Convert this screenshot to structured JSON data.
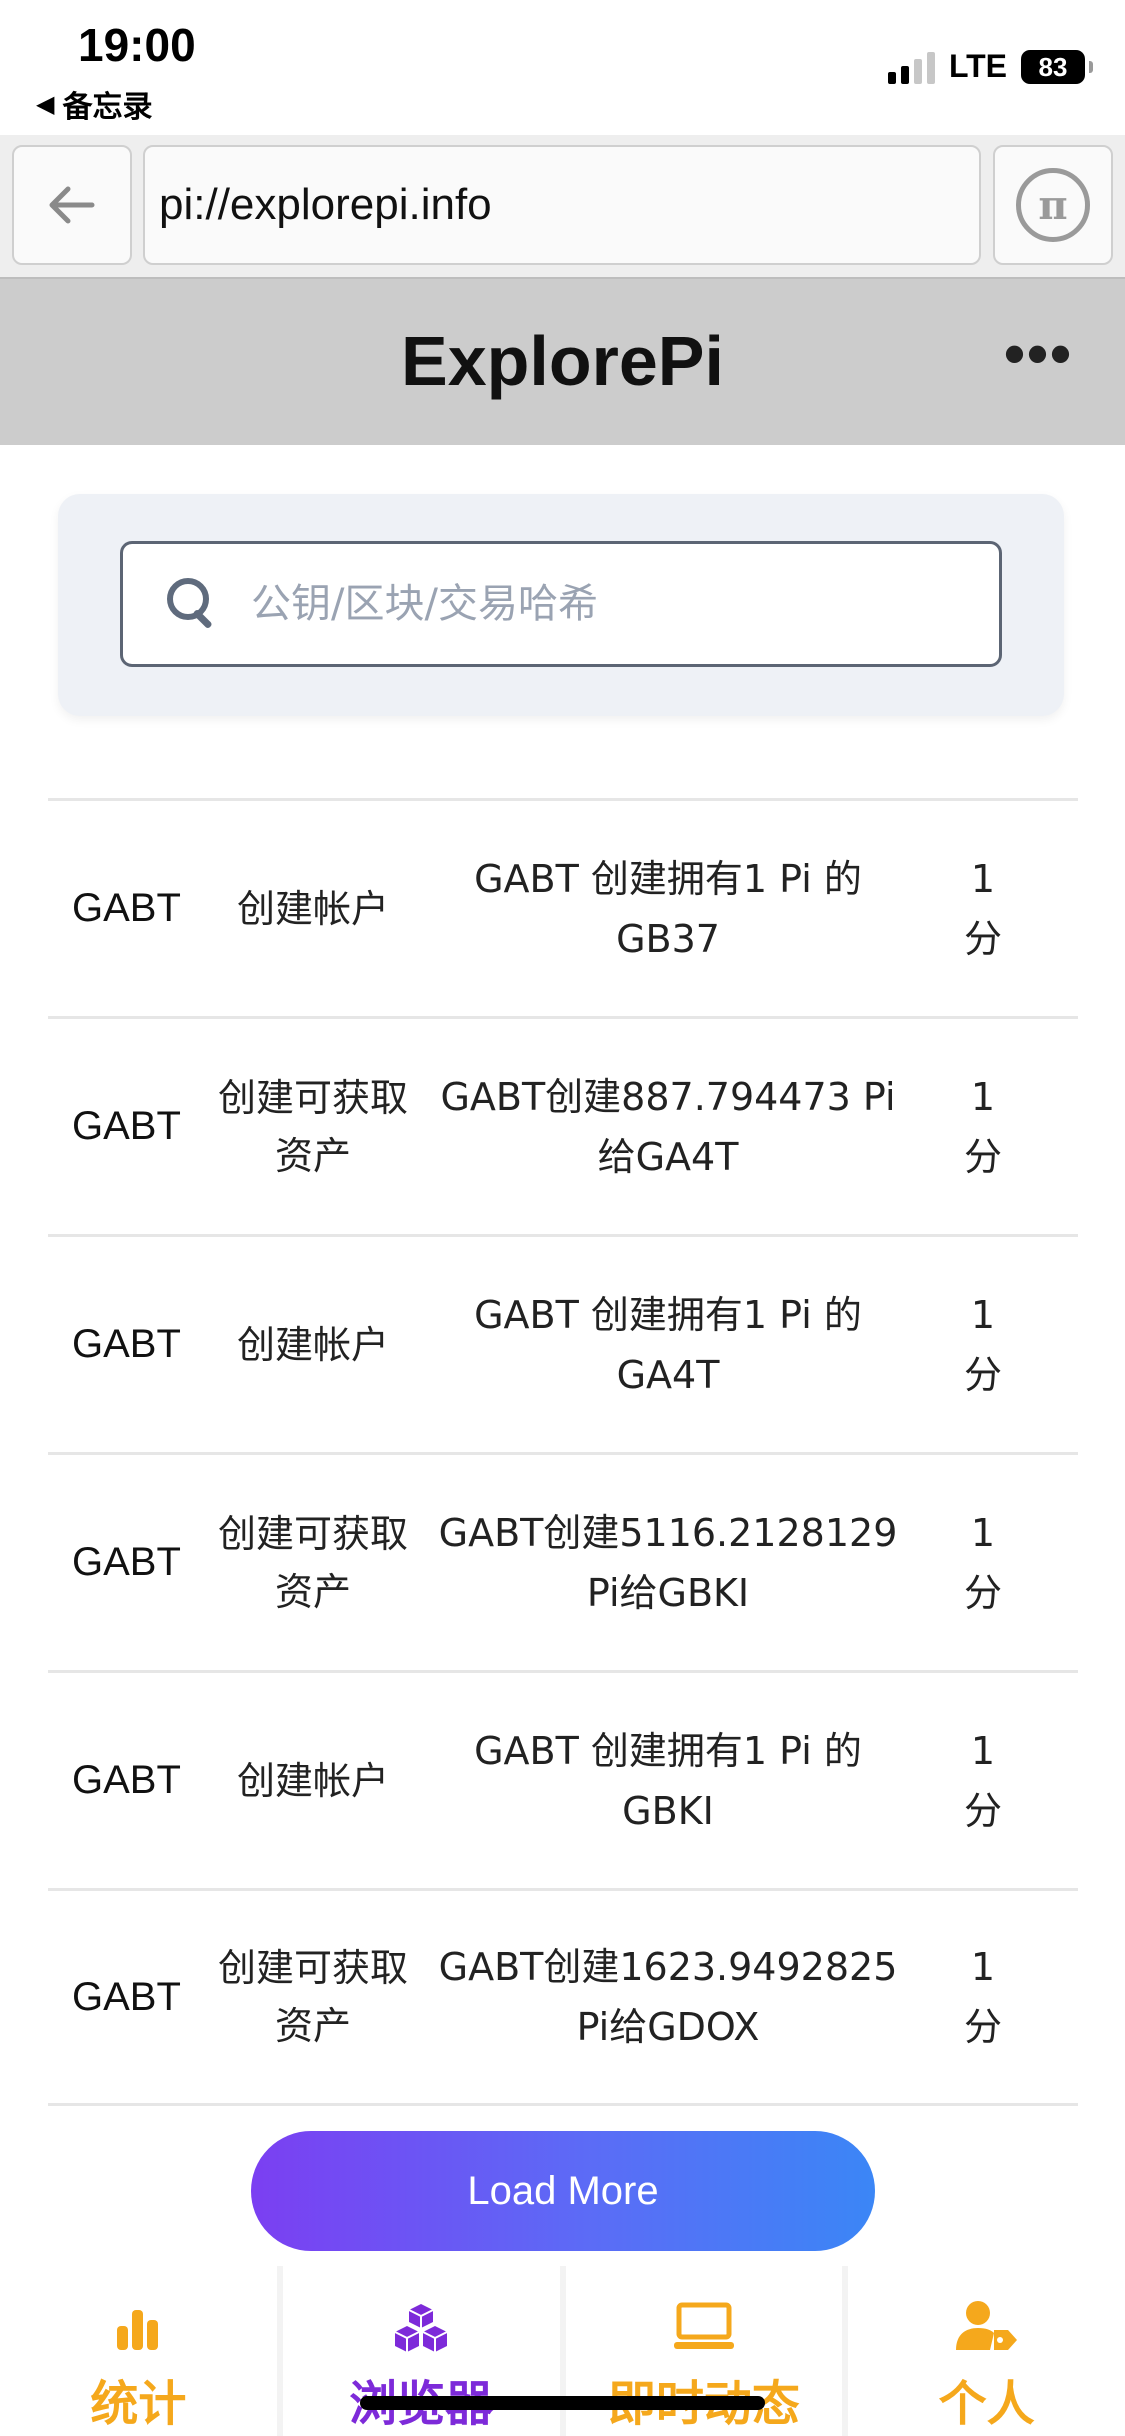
{
  "status_bar": {
    "time": "19:00",
    "back_app": "备忘录",
    "network": "LTE",
    "battery": "83"
  },
  "browser": {
    "url": "pi://explorepi.info"
  },
  "header": {
    "title": "ExplorePi",
    "more": "•••"
  },
  "search": {
    "placeholder": "公钥/区块/交易哈希"
  },
  "transactions": [
    {
      "account": "GABT",
      "type": "创建帐户",
      "desc": "GABT 创建拥有1 Pi 的 GB37",
      "time": "1 分"
    },
    {
      "account": "GABT",
      "type": "创建可获取资产",
      "desc": "GABT创建887.794473 Pi给GA4T",
      "time": "1 分"
    },
    {
      "account": "GABT",
      "type": "创建帐户",
      "desc": "GABT 创建拥有1 Pi 的 GA4T",
      "time": "1 分"
    },
    {
      "account": "GABT",
      "type": "创建可获取资产",
      "desc": "GABT创建5116.2128129 Pi给GBKI",
      "time": "1 分"
    },
    {
      "account": "GABT",
      "type": "创建帐户",
      "desc": "GABT 创建拥有1 Pi 的 GBKI",
      "time": "1 分"
    },
    {
      "account": "GABT",
      "type": "创建可获取资产",
      "desc": "GABT创建1623.9492825 Pi给GDOX",
      "time": "1 分"
    }
  ],
  "load_more": "Load More",
  "tabs": [
    {
      "label": "统计",
      "icon": "bar-chart-icon"
    },
    {
      "label": "浏览器",
      "icon": "blocks-icon"
    },
    {
      "label": "即时动态",
      "icon": "monitor-icon"
    },
    {
      "label": "个人",
      "icon": "user-tag-icon"
    }
  ],
  "colors": {
    "accent_orange": "#f5a81c",
    "accent_purple": "#7d2ad9",
    "button_gradient_start": "#7b3ff2",
    "button_gradient_end": "#3b86f6"
  }
}
